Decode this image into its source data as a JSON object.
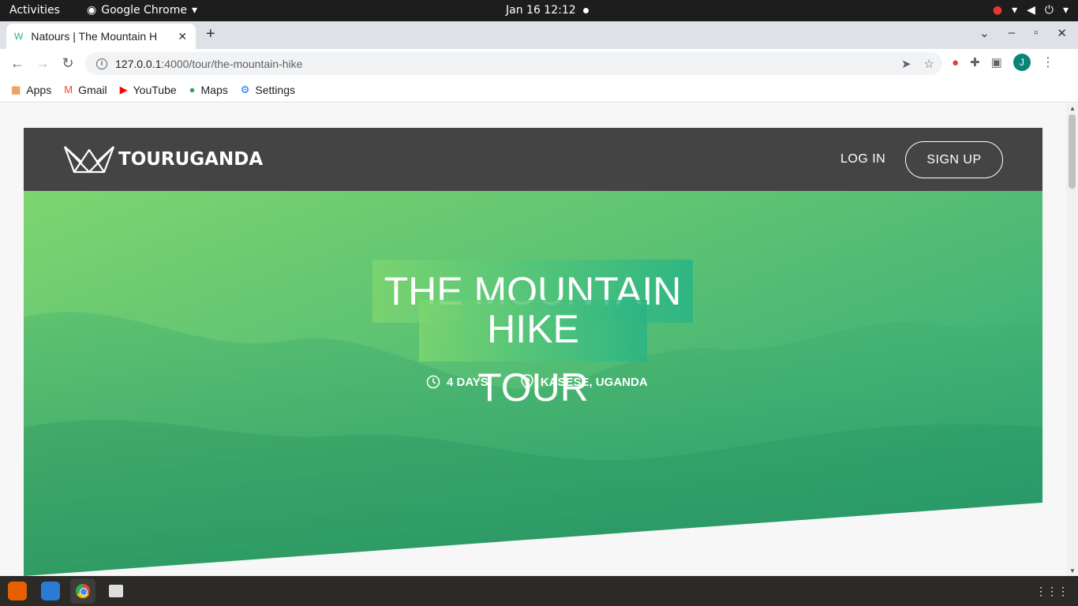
{
  "topbar": {
    "activities": "Activities",
    "app_name": "Google Chrome",
    "clock": "Jan 16  12:12"
  },
  "tab": {
    "title": "Natours | The Mountain H",
    "favicon": "natours-logo-icon"
  },
  "toolbar": {
    "url_host": "127.0.0.1",
    "url_path": ":4000/tour/the-mountain-hike",
    "profile_initial": "J"
  },
  "bookmarks": [
    {
      "label": "Apps",
      "icon": "apps-grid-icon"
    },
    {
      "label": "Gmail",
      "icon": "gmail-icon"
    },
    {
      "label": "YouTube",
      "icon": "youtube-icon"
    },
    {
      "label": "Maps",
      "icon": "maps-pin-icon"
    },
    {
      "label": "Settings",
      "icon": "gear-icon"
    }
  ],
  "site": {
    "brand": "TOURUGANDA",
    "login": "LOG IN",
    "signup": "SIGN UP",
    "tour_title_line1": "THE MOUNTAIN",
    "tour_title_line2": "HIKE TOUR",
    "duration": "4 DAYS",
    "location": "KASESE, UGANDA"
  },
  "colors": {
    "header_bg": "#444444",
    "hero_gradient_start": "#7dd56f",
    "hero_gradient_end": "#28b485"
  }
}
